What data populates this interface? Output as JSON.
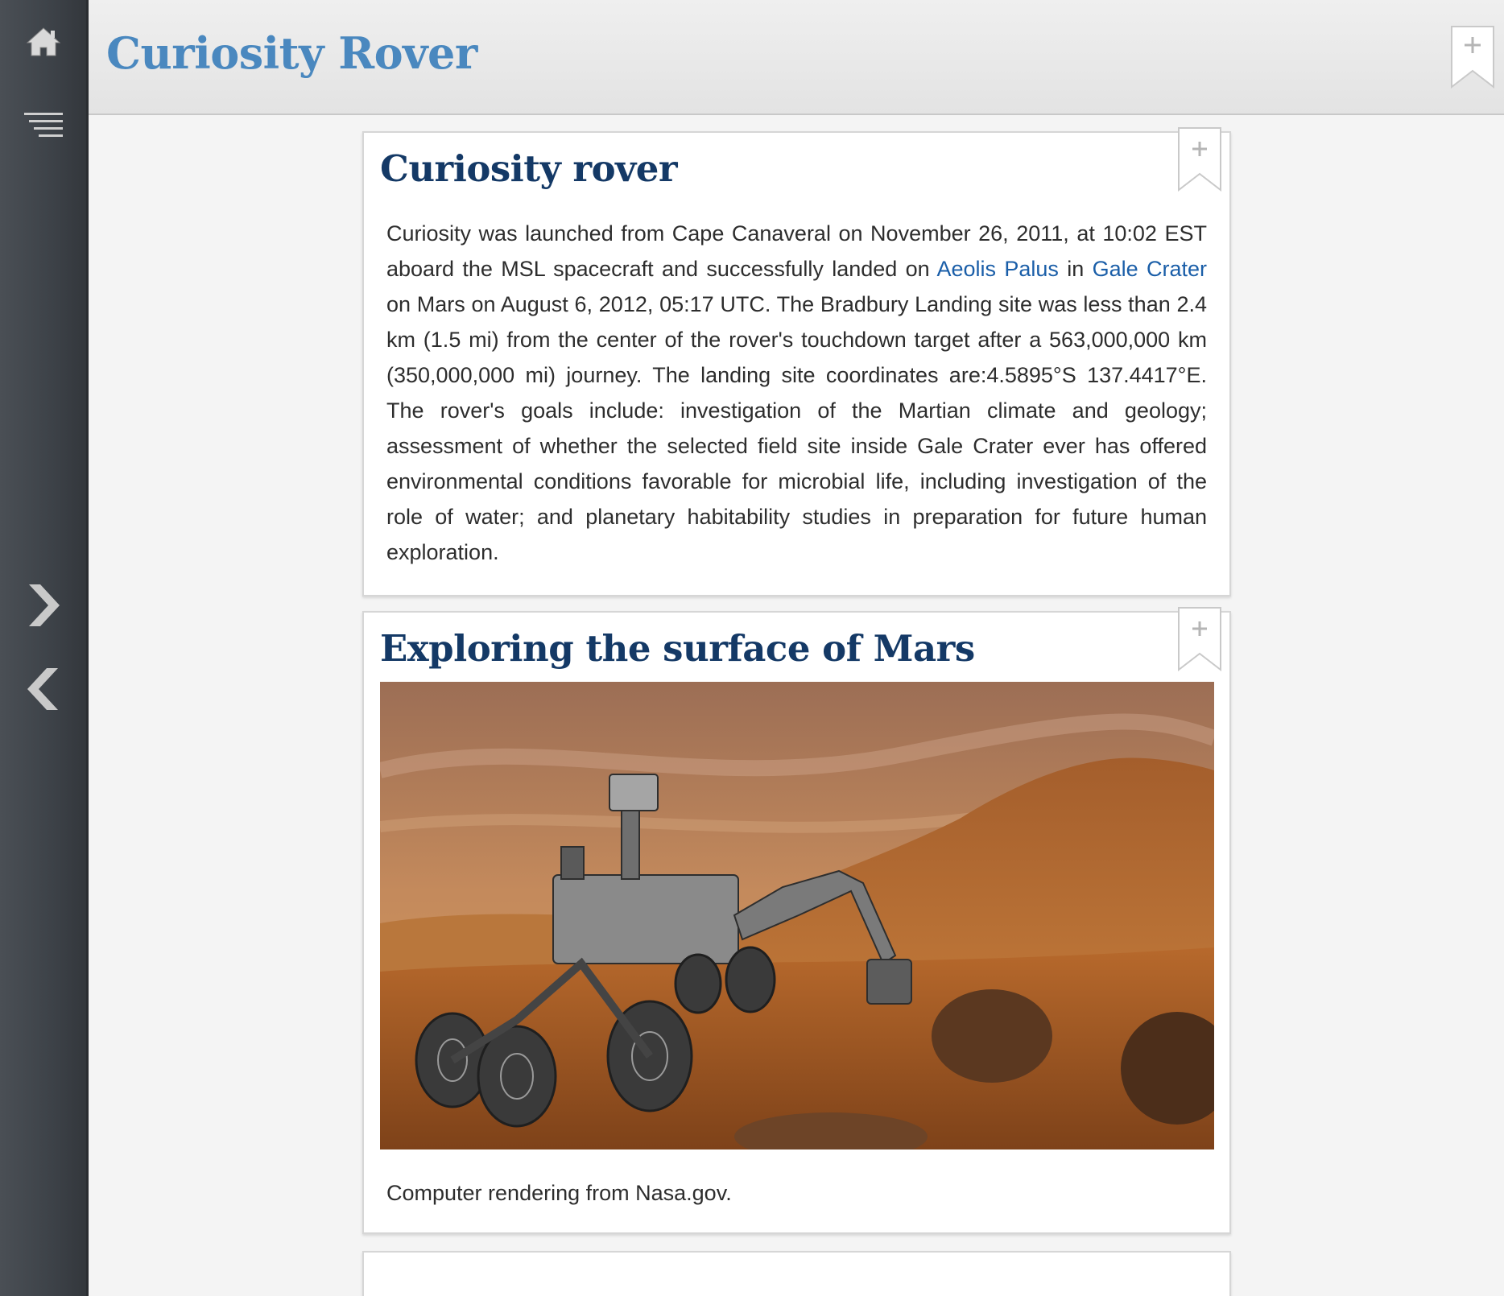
{
  "sidebar": {
    "home_icon": "home-icon",
    "menu_icon": "menu-icon",
    "next_icon": "chevron-right-icon",
    "prev_icon": "chevron-left-icon"
  },
  "header": {
    "title": "Curiosity Rover",
    "bookmark_icon": "bookmark-add-icon"
  },
  "cards": [
    {
      "title": "Curiosity rover",
      "paragraph": {
        "before_link1": "Curiosity was launched from Cape Canaveral on November 26, 2011, at 10:02 EST aboard the MSL spacecraft and successfully landed on ",
        "link1": "Aeolis Palus",
        "between_links": " in ",
        "link2": "Gale Crater",
        "after_link2": " on Mars on August 6, 2012, 05:17 UTC. The Bradbury Landing site was less than 2.4 km (1.5 mi) from the center of the rover's touchdown target after a 563,000,000 km (350,000,000 mi) journey. The landing site coordinates are:4.5895°S 137.4417°E. The rover's goals include: investigation of the Martian climate and geology; assessment of whether the selected field site inside Gale Crater ever has offered environmental conditions favorable for microbial life, including investigation of the role of water; and planetary habitability studies in preparation for future human exploration."
      }
    },
    {
      "title": "Exploring the surface of Mars",
      "caption": "Computer rendering from Nasa.gov."
    }
  ],
  "colors": {
    "header_title": "#4a88bf",
    "card_title": "#143966",
    "link": "#1a5ea8",
    "sidebar": "#3d4248"
  }
}
